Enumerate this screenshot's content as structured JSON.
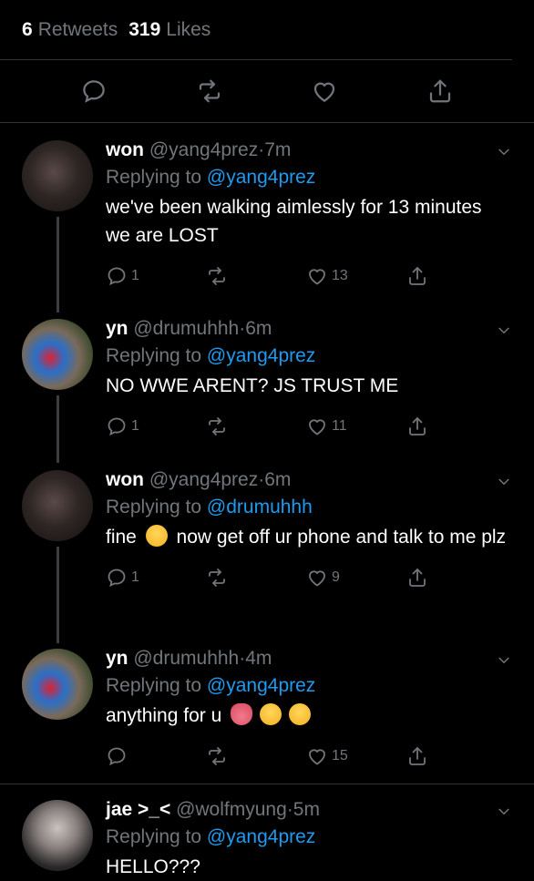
{
  "stats": {
    "retweets_count": "6",
    "retweets_label": "Retweets",
    "likes_count": "319",
    "likes_label": "Likes"
  },
  "actions": {
    "icons": [
      "reply-icon",
      "retweet-icon",
      "like-icon",
      "share-icon"
    ]
  },
  "replies": [
    {
      "name": "won",
      "handle": "@yang4prez",
      "time": "7m",
      "replying_prefix": "Replying to",
      "replying_to": "@yang4prez",
      "text": "we've been walking aimlessly for 13 minutes we are LOST",
      "reply_count": "1",
      "retweet_count": "",
      "like_count": "13"
    },
    {
      "name": "yn",
      "handle": "@drumuhhh",
      "time": "6m",
      "replying_prefix": "Replying to",
      "replying_to": "@yang4prez",
      "text": "NO WWE ARENT? JS TRUST ME",
      "reply_count": "1",
      "retweet_count": "",
      "like_count": "11"
    },
    {
      "name": "won",
      "handle": "@yang4prez",
      "time": "6m",
      "replying_prefix": "Replying to",
      "replying_to": "@drumuhhh",
      "text_before": "fine",
      "text_after": "now get off ur phone and talk to me plz",
      "reply_count": "1",
      "retweet_count": "",
      "like_count": "9"
    },
    {
      "name": "yn",
      "handle": "@drumuhhh",
      "time": "4m",
      "replying_prefix": "Replying to",
      "replying_to": "@yang4prez",
      "text": "anything for u",
      "reply_count": "",
      "retweet_count": "",
      "like_count": "15"
    },
    {
      "name": "jae >_<",
      "handle": "@wolfmyung",
      "time": "5m",
      "replying_prefix": "Replying to",
      "replying_to": "@yang4prez",
      "text": "HELLO???"
    }
  ],
  "colors": {
    "accent": "#1d9bf0",
    "muted": "#71767b",
    "background": "#000000"
  }
}
